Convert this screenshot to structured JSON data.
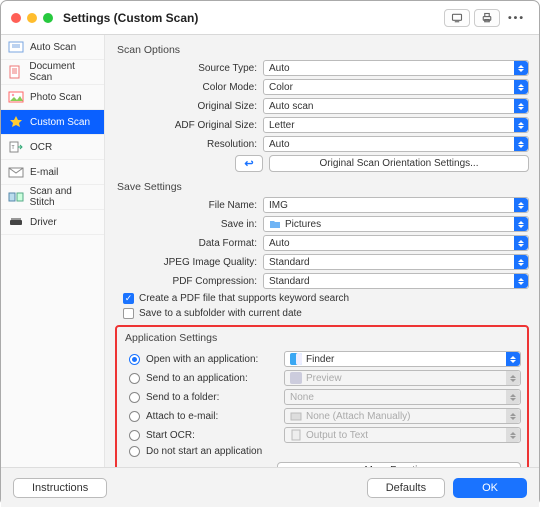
{
  "window": {
    "title": "Settings (Custom Scan)"
  },
  "sidebar": {
    "items": [
      {
        "label": "Auto Scan"
      },
      {
        "label": "Document Scan"
      },
      {
        "label": "Photo Scan"
      },
      {
        "label": "Custom Scan"
      },
      {
        "label": "OCR"
      },
      {
        "label": "E-mail"
      },
      {
        "label": "Scan and Stitch"
      },
      {
        "label": "Driver"
      }
    ]
  },
  "scan_options": {
    "heading": "Scan Options",
    "source_type_label": "Source Type:",
    "source_type_value": "Auto",
    "color_mode_label": "Color Mode:",
    "color_mode_value": "Color",
    "original_size_label": "Original Size:",
    "original_size_value": "Auto scan",
    "adf_label": "ADF Original Size:",
    "adf_value": "Letter",
    "resolution_label": "Resolution:",
    "resolution_value": "Auto",
    "rotate_icon": "↩︎",
    "orientation_btn": "Original Scan Orientation Settings..."
  },
  "save_settings": {
    "heading": "Save Settings",
    "file_name_label": "File Name:",
    "file_name_value": "IMG",
    "save_in_label": "Save in:",
    "save_in_value": "Pictures",
    "data_format_label": "Data Format:",
    "data_format_value": "Auto",
    "jpeg_label": "JPEG Image Quality:",
    "jpeg_value": "Standard",
    "pdf_comp_label": "PDF Compression:",
    "pdf_comp_value": "Standard",
    "chk_keyword": "Create a PDF file that supports keyword search",
    "chk_subfolder": "Save to a subfolder with current date"
  },
  "app_settings": {
    "heading": "Application Settings",
    "open_with_label": "Open with an application:",
    "open_with_value": "Finder",
    "send_app_label": "Send to an application:",
    "send_app_value": "Preview",
    "send_folder_label": "Send to a folder:",
    "send_folder_value": "None",
    "attach_label": "Attach to e-mail:",
    "attach_value": "None (Attach Manually)",
    "ocr_label": "Start OCR:",
    "ocr_value": "Output to Text",
    "no_start_label": "Do not start an application",
    "more_functions": "More Functions"
  },
  "footer": {
    "instructions": "Instructions",
    "defaults": "Defaults",
    "ok": "OK"
  }
}
